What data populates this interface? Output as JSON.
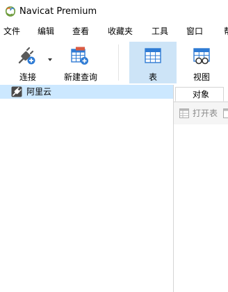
{
  "window": {
    "title": "Navicat Premium"
  },
  "menu": [
    "文件",
    "编辑",
    "查看",
    "收藏夹",
    "工具",
    "窗口",
    "帮"
  ],
  "toolbar": {
    "connect_label": "连接",
    "new_query_label": "新建查询",
    "table_label": "表",
    "view_label": "视图"
  },
  "tree": {
    "items": [
      {
        "label": "阿里云",
        "icon": "connection-plug-icon"
      }
    ]
  },
  "objects": {
    "tab_label": "对象",
    "open_table_label": "打开表"
  },
  "colors": {
    "accent": "#cde4f7",
    "selection": "#cce8ff",
    "icon_blue": "#2f7bd4",
    "icon_red": "#d95b43"
  }
}
